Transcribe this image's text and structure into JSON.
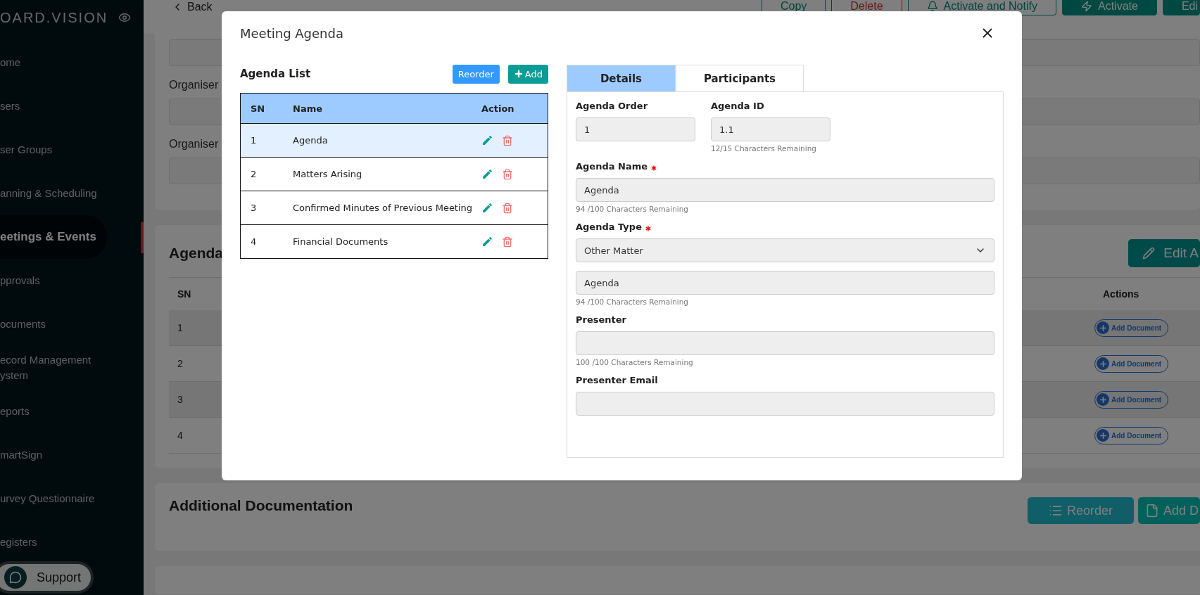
{
  "sidebar": {
    "brand": "OARD.VISION",
    "items": [
      {
        "label": "ome",
        "selected": false
      },
      {
        "label": "sers",
        "selected": false
      },
      {
        "label": "ser Groups",
        "selected": false
      },
      {
        "label": "anning & Scheduling",
        "selected": false
      },
      {
        "label": "eetings & Events",
        "selected": true
      },
      {
        "label": "pprovals",
        "selected": false
      },
      {
        "label": "ocuments",
        "selected": false
      },
      {
        "label": "ecord Management ystem",
        "selected": false
      },
      {
        "label": "eports",
        "selected": false
      },
      {
        "label": "martSign",
        "selected": false
      },
      {
        "label": "urvey Questionnaire",
        "selected": false
      },
      {
        "label": "egisters",
        "selected": false
      }
    ],
    "support": "Support"
  },
  "topbar": {
    "back": "Back",
    "buttons": [
      {
        "label": "Copy",
        "kind": "outline"
      },
      {
        "label": "Delete",
        "kind": "danger"
      },
      {
        "label": "Activate and Notify",
        "kind": "outline"
      },
      {
        "label": "Activate",
        "kind": "solid"
      },
      {
        "label": "Edi",
        "kind": "solid"
      }
    ]
  },
  "organiser_card": {
    "labels": [
      "Organiser",
      "Organiser"
    ]
  },
  "agenda_section": {
    "title": "Agenda",
    "edit_button": "Edit A",
    "columns": [
      "SN",
      "Actions"
    ],
    "rows": [
      {
        "sn": "1",
        "action": "Add Document"
      },
      {
        "sn": "2",
        "action": "Add Document"
      },
      {
        "sn": "3",
        "action": "Add Document"
      },
      {
        "sn": "4",
        "action": "Add Document"
      }
    ]
  },
  "additional_documentation": {
    "title": "Additional Documentation",
    "buttons": [
      "Reorder",
      "Add D"
    ]
  },
  "modal": {
    "title": "Meeting Agenda",
    "agenda_list": {
      "title": "Agenda List",
      "buttons": [
        "Reorder",
        "Add"
      ],
      "columns": [
        "SN",
        "Name",
        "Action"
      ],
      "rows": [
        {
          "sn": "1",
          "name": "Agenda",
          "selected": true
        },
        {
          "sn": "2",
          "name": "Matters Arising",
          "selected": false
        },
        {
          "sn": "3",
          "name": "Confirmed Minutes of Previous Meeting",
          "selected": false
        },
        {
          "sn": "4",
          "name": "Financial Documents",
          "selected": false
        }
      ]
    },
    "tabs": [
      {
        "label": "Details",
        "selected": true
      },
      {
        "label": "Participants",
        "selected": false
      }
    ],
    "details": {
      "rows": [
        [
          {
            "kind": "input",
            "label": "Agenda Order",
            "required": false,
            "value": "1"
          },
          {
            "kind": "input",
            "label": "Agenda ID",
            "required": false,
            "value": "1.1",
            "hint": "12/15 Characters Remaining"
          }
        ],
        [
          {
            "kind": "input",
            "label": "Agenda Name",
            "required": true,
            "value": "Agenda",
            "hint": "94 /100 Characters Remaining"
          }
        ],
        [
          {
            "kind": "select",
            "label": "Agenda Type",
            "required": true,
            "value": "Other Matter"
          }
        ],
        [
          {
            "kind": "input",
            "value": "Agenda",
            "hint": "94 /100 Characters Remaining"
          }
        ],
        [
          {
            "kind": "input",
            "label": "Presenter",
            "required": false,
            "hint": "100 /100 Characters Remaining"
          }
        ],
        [
          {
            "kind": "input",
            "label": "Presenter Email",
            "required": false
          }
        ]
      ]
    }
  }
}
